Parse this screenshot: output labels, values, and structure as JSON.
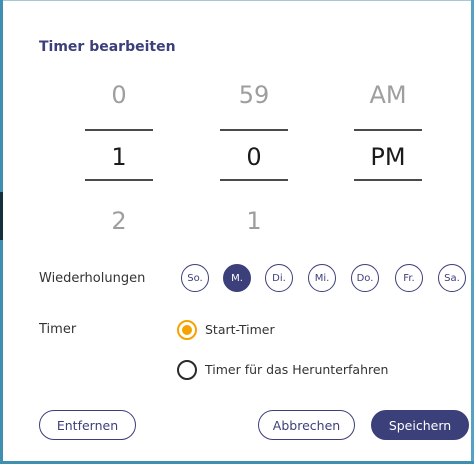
{
  "dialog": {
    "title": "Timer bearbeiten"
  },
  "picker": {
    "hours": {
      "prev": "0",
      "selected": "1",
      "next": "2"
    },
    "minutes": {
      "prev": "59",
      "selected": "0",
      "next": "1"
    },
    "ampm": {
      "prev": "AM",
      "selected": "PM",
      "next": ""
    }
  },
  "repeat": {
    "label": "Wiederholungen",
    "days": [
      {
        "label": "So.",
        "selected": false
      },
      {
        "label": "M.",
        "selected": true
      },
      {
        "label": "Di.",
        "selected": false
      },
      {
        "label": "Mi.",
        "selected": false
      },
      {
        "label": "Do.",
        "selected": false
      },
      {
        "label": "Fr.",
        "selected": false
      },
      {
        "label": "Sa.",
        "selected": false
      }
    ]
  },
  "timer": {
    "label": "Timer",
    "options": [
      {
        "label": "Start-Timer",
        "selected": true
      },
      {
        "label": "Timer für das Herunterfahren",
        "selected": false
      }
    ]
  },
  "buttons": {
    "remove": "Entfernen",
    "cancel": "Abbrechen",
    "save": "Speichern"
  },
  "colors": {
    "accent": "#3b3f7a",
    "radio_selected": "#f5a300",
    "frame_edge": "#3f8fb0"
  }
}
